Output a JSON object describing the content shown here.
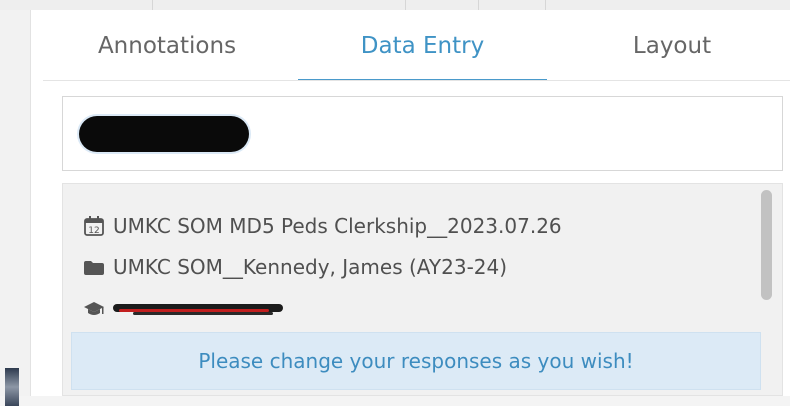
{
  "tabs": [
    {
      "label": "Annotations",
      "active": false
    },
    {
      "label": "Data Entry",
      "active": true
    },
    {
      "label": "Layout",
      "active": false
    }
  ],
  "record": {
    "selected_value_redacted": true,
    "rows": [
      {
        "icon": "calendar-icon",
        "text": "UMKC SOM MD5 Peds Clerkship__2023.07.26"
      },
      {
        "icon": "folder-icon",
        "text": "UMKC SOM__Kennedy, James (AY23-24)"
      },
      {
        "icon": "graduation-cap-icon",
        "text": "",
        "redacted": true
      }
    ]
  },
  "notice": {
    "text": "Please change your responses as you wish!"
  },
  "colors": {
    "accent": "#3f93c5",
    "notice_background": "#dceaf6",
    "tab_text": "#666666",
    "row_text": "#505050"
  }
}
